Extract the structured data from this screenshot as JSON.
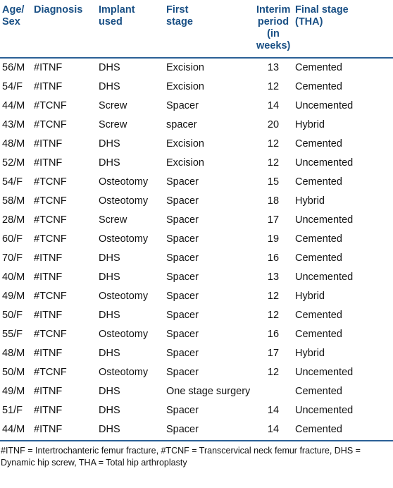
{
  "table": {
    "columns": [
      {
        "key": "age_sex",
        "label": "Age/ Sex"
      },
      {
        "key": "diagnosis",
        "label": "Diagnosis"
      },
      {
        "key": "implant",
        "label": "Implant used"
      },
      {
        "key": "first_stage",
        "label": "First stage"
      },
      {
        "key": "interim",
        "label": "Interim period (in weeks)"
      },
      {
        "key": "final_stage",
        "label": "Final stage (THA)"
      }
    ],
    "header_lines": {
      "age_sex": [
        "Age/",
        "Sex"
      ],
      "diagnosis": [
        "Diagnosis"
      ],
      "implant": [
        "Implant",
        "used"
      ],
      "first_stage": [
        "First",
        "stage"
      ],
      "interim": [
        "Interim",
        "period",
        "(in",
        "weeks)"
      ],
      "final_stage": [
        "Final stage",
        "(THA)"
      ]
    },
    "rows": [
      {
        "age_sex": "56/M",
        "diagnosis": "#ITNF",
        "implant": "DHS",
        "first_stage": "Excision",
        "interim": "13",
        "final_stage": "Cemented"
      },
      {
        "age_sex": "54/F",
        "diagnosis": "#ITNF",
        "implant": "DHS",
        "first_stage": "Excision",
        "interim": "12",
        "final_stage": "Cemented"
      },
      {
        "age_sex": "44/M",
        "diagnosis": "#TCNF",
        "implant": "Screw",
        "first_stage": "Spacer",
        "interim": "14",
        "final_stage": "Uncemented"
      },
      {
        "age_sex": "43/M",
        "diagnosis": "#TCNF",
        "implant": "Screw",
        "first_stage": "spacer",
        "interim": "20",
        "final_stage": "Hybrid"
      },
      {
        "age_sex": "48/M",
        "diagnosis": "#ITNF",
        "implant": "DHS",
        "first_stage": "Excision",
        "interim": "12",
        "final_stage": "Cemented"
      },
      {
        "age_sex": "52/M",
        "diagnosis": "#ITNF",
        "implant": "DHS",
        "first_stage": "Excision",
        "interim": "12",
        "final_stage": "Uncemented"
      },
      {
        "age_sex": "54/F",
        "diagnosis": "#TCNF",
        "implant": "Osteotomy",
        "first_stage": "Spacer",
        "interim": "15",
        "final_stage": "Cemented"
      },
      {
        "age_sex": "58/M",
        "diagnosis": "#TCNF",
        "implant": "Osteotomy",
        "first_stage": "Spacer",
        "interim": "18",
        "final_stage": "Hybrid"
      },
      {
        "age_sex": "28/M",
        "diagnosis": "#TCNF",
        "implant": "Screw",
        "first_stage": "Spacer",
        "interim": "17",
        "final_stage": "Uncemented"
      },
      {
        "age_sex": "60/F",
        "diagnosis": "#TCNF",
        "implant": "Osteotomy",
        "first_stage": "Spacer",
        "interim": "19",
        "final_stage": "Cemented"
      },
      {
        "age_sex": "70/F",
        "diagnosis": "#ITNF",
        "implant": "DHS",
        "first_stage": "Spacer",
        "interim": "16",
        "final_stage": "Cemented"
      },
      {
        "age_sex": "40/M",
        "diagnosis": "#ITNF",
        "implant": "DHS",
        "first_stage": "Spacer",
        "interim": "13",
        "final_stage": "Uncemented"
      },
      {
        "age_sex": "49/M",
        "diagnosis": "#TCNF",
        "implant": "Osteotomy",
        "first_stage": "Spacer",
        "interim": "12",
        "final_stage": "Hybrid"
      },
      {
        "age_sex": "50/F",
        "diagnosis": "#ITNF",
        "implant": "DHS",
        "first_stage": "Spacer",
        "interim": "12",
        "final_stage": "Cemented"
      },
      {
        "age_sex": "55/F",
        "diagnosis": "#TCNF",
        "implant": "Osteotomy",
        "first_stage": "Spacer",
        "interim": "16",
        "final_stage": "Cemented"
      },
      {
        "age_sex": "48/M",
        "diagnosis": "#ITNF",
        "implant": "DHS",
        "first_stage": "Spacer",
        "interim": "17",
        "final_stage": "Hybrid"
      },
      {
        "age_sex": "50/M",
        "diagnosis": "#TCNF",
        "implant": "Osteotomy",
        "first_stage": "Spacer",
        "interim": "12",
        "final_stage": "Uncemented"
      },
      {
        "age_sex": "49/M",
        "diagnosis": "#ITNF",
        "implant": "DHS",
        "first_stage": "One stage surgery",
        "interim": "",
        "final_stage": "Cemented"
      },
      {
        "age_sex": "51/F",
        "diagnosis": "#ITNF",
        "implant": "DHS",
        "first_stage": "Spacer",
        "interim": "14",
        "final_stage": "Uncemented"
      },
      {
        "age_sex": "44/M",
        "diagnosis": "#ITNF",
        "implant": "DHS",
        "first_stage": "Spacer",
        "interim": "14",
        "final_stage": "Cemented"
      }
    ],
    "footnote": "#ITNF = Intertrochanteric femur fracture, #TCNF = Transcervical neck femur fracture, DHS = Dynamic hip screw, THA = Total hip arthroplasty"
  },
  "colors": {
    "header_text": "#1a5085",
    "rule": "#2a6096",
    "body_text": "#131313",
    "background": "#ffffff"
  }
}
